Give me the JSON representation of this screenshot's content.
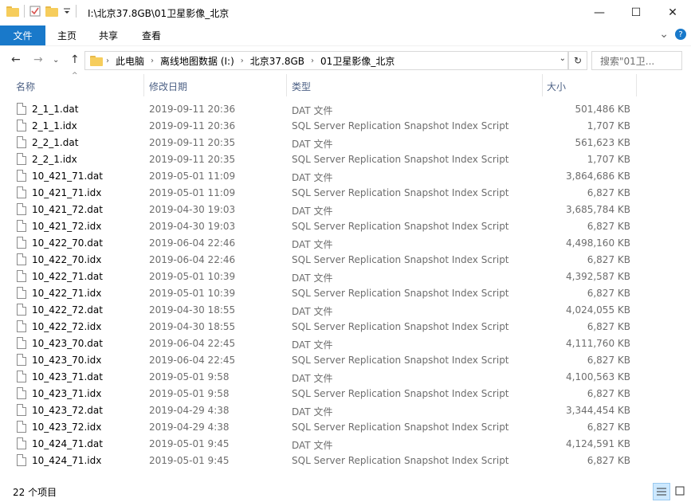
{
  "window": {
    "title": "I:\\北京37.8GB\\01卫星影像_北京",
    "minimize_glyph": "—",
    "maximize_glyph": "☐",
    "close_glyph": "✕"
  },
  "ribbon": {
    "tabs": [
      "文件",
      "主页",
      "共享",
      "查看"
    ],
    "expand_glyph": "⌄",
    "help_glyph": "?"
  },
  "nav": {
    "back_glyph": "←",
    "forward_glyph": "→",
    "recent_glyph": "⌄",
    "up_glyph": "↑",
    "refresh_glyph": "↻",
    "breadcrumb": [
      "此电脑",
      "离线地图数据 (I:)",
      "北京37.8GB",
      "01卫星影像_北京"
    ],
    "search_placeholder": "搜索\"01卫..."
  },
  "columns": {
    "name": "名称",
    "date": "修改日期",
    "type": "类型",
    "size": "大小",
    "sort_glyph": "^"
  },
  "files": [
    {
      "name": "2_1_1.dat",
      "date": "2019-09-11 20:36",
      "type": "DAT 文件",
      "size": "501,486 KB"
    },
    {
      "name": "2_1_1.idx",
      "date": "2019-09-11 20:36",
      "type": "SQL Server Replication Snapshot Index Script",
      "size": "1,707 KB"
    },
    {
      "name": "2_2_1.dat",
      "date": "2019-09-11 20:35",
      "type": "DAT 文件",
      "size": "561,623 KB"
    },
    {
      "name": "2_2_1.idx",
      "date": "2019-09-11 20:35",
      "type": "SQL Server Replication Snapshot Index Script",
      "size": "1,707 KB"
    },
    {
      "name": "10_421_71.dat",
      "date": "2019-05-01 11:09",
      "type": "DAT 文件",
      "size": "3,864,686 KB"
    },
    {
      "name": "10_421_71.idx",
      "date": "2019-05-01 11:09",
      "type": "SQL Server Replication Snapshot Index Script",
      "size": "6,827 KB"
    },
    {
      "name": "10_421_72.dat",
      "date": "2019-04-30 19:03",
      "type": "DAT 文件",
      "size": "3,685,784 KB"
    },
    {
      "name": "10_421_72.idx",
      "date": "2019-04-30 19:03",
      "type": "SQL Server Replication Snapshot Index Script",
      "size": "6,827 KB"
    },
    {
      "name": "10_422_70.dat",
      "date": "2019-06-04 22:46",
      "type": "DAT 文件",
      "size": "4,498,160 KB"
    },
    {
      "name": "10_422_70.idx",
      "date": "2019-06-04 22:46",
      "type": "SQL Server Replication Snapshot Index Script",
      "size": "6,827 KB"
    },
    {
      "name": "10_422_71.dat",
      "date": "2019-05-01 10:39",
      "type": "DAT 文件",
      "size": "4,392,587 KB"
    },
    {
      "name": "10_422_71.idx",
      "date": "2019-05-01 10:39",
      "type": "SQL Server Replication Snapshot Index Script",
      "size": "6,827 KB"
    },
    {
      "name": "10_422_72.dat",
      "date": "2019-04-30 18:55",
      "type": "DAT 文件",
      "size": "4,024,055 KB"
    },
    {
      "name": "10_422_72.idx",
      "date": "2019-04-30 18:55",
      "type": "SQL Server Replication Snapshot Index Script",
      "size": "6,827 KB"
    },
    {
      "name": "10_423_70.dat",
      "date": "2019-06-04 22:45",
      "type": "DAT 文件",
      "size": "4,111,760 KB"
    },
    {
      "name": "10_423_70.idx",
      "date": "2019-06-04 22:45",
      "type": "SQL Server Replication Snapshot Index Script",
      "size": "6,827 KB"
    },
    {
      "name": "10_423_71.dat",
      "date": "2019-05-01 9:58",
      "type": "DAT 文件",
      "size": "4,100,563 KB"
    },
    {
      "name": "10_423_71.idx",
      "date": "2019-05-01 9:58",
      "type": "SQL Server Replication Snapshot Index Script",
      "size": "6,827 KB"
    },
    {
      "name": "10_423_72.dat",
      "date": "2019-04-29 4:38",
      "type": "DAT 文件",
      "size": "3,344,454 KB"
    },
    {
      "name": "10_423_72.idx",
      "date": "2019-04-29 4:38",
      "type": "SQL Server Replication Snapshot Index Script",
      "size": "6,827 KB"
    },
    {
      "name": "10_424_71.dat",
      "date": "2019-05-01 9:45",
      "type": "DAT 文件",
      "size": "4,124,591 KB"
    },
    {
      "name": "10_424_71.idx",
      "date": "2019-05-01 9:45",
      "type": "SQL Server Replication Snapshot Index Script",
      "size": "6,827 KB"
    }
  ],
  "status": {
    "item_count": "22 个项目"
  },
  "colors": {
    "file_tab": "#1979ca",
    "header_text": "#4d6185"
  }
}
